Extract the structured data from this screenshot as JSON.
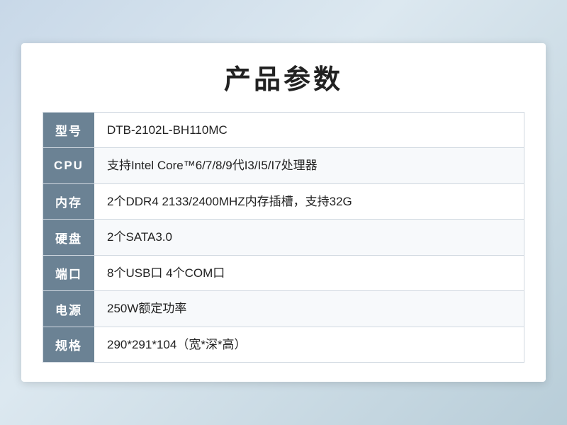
{
  "page": {
    "title": "产品参数",
    "specs": [
      {
        "label": "型号",
        "value": " DTB-2102L-BH110MC"
      },
      {
        "label": "CPU",
        "value": "支持Intel Core™6/7/8/9代I3/I5/I7处理器"
      },
      {
        "label": "内存",
        "value": "2个DDR4 2133/2400MHZ内存插槽，支持32G"
      },
      {
        "label": "硬盘",
        "value": "2个SATA3.0"
      },
      {
        "label": "端口",
        "value": "8个USB口 4个COM口"
      },
      {
        "label": "电源",
        "value": "250W额定功率"
      },
      {
        "label": "规格",
        "value": "290*291*104（宽*深*高）"
      }
    ]
  }
}
